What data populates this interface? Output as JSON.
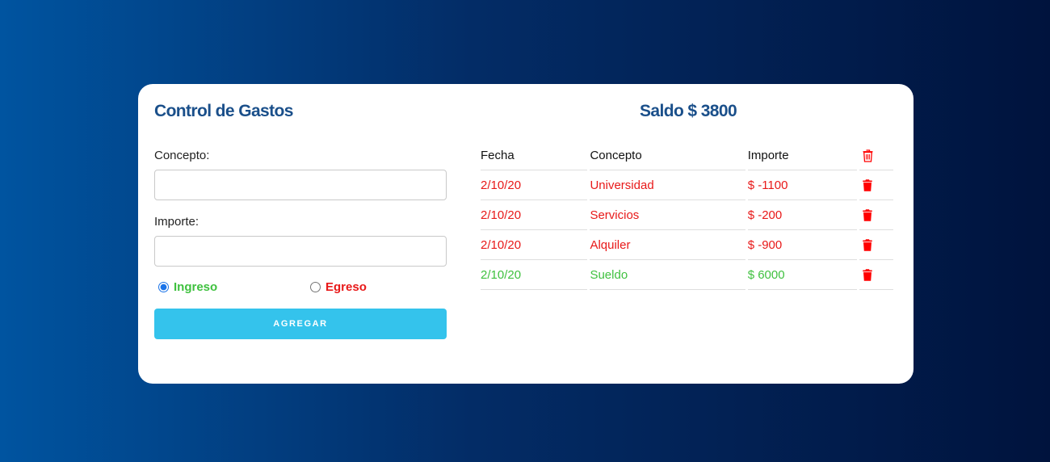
{
  "app": {
    "title": "Control de Gastos"
  },
  "balance": {
    "text": "Saldo $ 3800"
  },
  "form": {
    "concept_label": "Concepto:",
    "concept_value": "",
    "amount_label": "Importe:",
    "amount_value": "",
    "type_options": [
      {
        "label": "Ingreso",
        "checked": true,
        "color": "#3fc13f"
      },
      {
        "label": "Egreso",
        "checked": false,
        "color": "#e81919"
      }
    ],
    "submit_label": "AGREGAR",
    "submit_color": "#34c3ec"
  },
  "table": {
    "headers": [
      "Fecha",
      "Concepto",
      "Importe"
    ],
    "header_icon": "trash-outline-icon",
    "rows": [
      {
        "date": "2/10/20",
        "concept": "Universidad",
        "amount": "$ -1100",
        "kind": "egreso",
        "icon": "trash-icon"
      },
      {
        "date": "2/10/20",
        "concept": "Servicios",
        "amount": "$ -200",
        "kind": "egreso",
        "icon": "trash-icon"
      },
      {
        "date": "2/10/20",
        "concept": "Alquiler",
        "amount": "$ -900",
        "kind": "egreso",
        "icon": "trash-icon"
      },
      {
        "date": "2/10/20",
        "concept": "Sueldo",
        "amount": "$ 6000",
        "kind": "ingreso",
        "icon": "trash-icon"
      }
    ]
  },
  "colors": {
    "expense": "#e81919",
    "income": "#3fc13f",
    "title": "#1a4f8a",
    "delete_icon": "#ff0000"
  }
}
